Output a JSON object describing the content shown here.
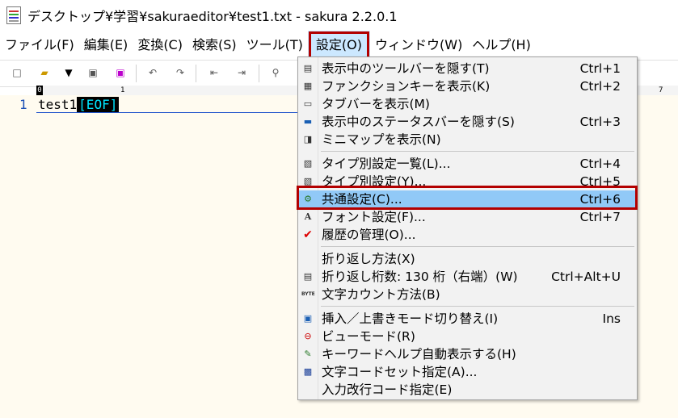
{
  "window": {
    "title": "デスクトップ¥学習¥sakuraeditor¥test1.txt - sakura 2.2.0.1"
  },
  "menubar": [
    "ファイル(F)",
    "編集(E)",
    "変換(C)",
    "検索(S)",
    "ツール(T)",
    "設定(O)",
    "ウィンドウ(W)",
    "ヘルプ(H)"
  ],
  "editor": {
    "line_number": "1",
    "text": "test1",
    "eof_marker": "[EOF]"
  },
  "ruler": {
    "start": "0",
    "mark10": "1",
    "mark70": "7"
  },
  "settings_menu": {
    "items": [
      {
        "label": "表示中のツールバーを隠す(T)",
        "shortcut": "Ctrl+1",
        "icon": "toolbar-icon"
      },
      {
        "label": "ファンクションキーを表示(K)",
        "shortcut": "Ctrl+2",
        "icon": "function-key-icon"
      },
      {
        "label": "タブバーを表示(M)",
        "shortcut": "",
        "icon": "tabbar-icon"
      },
      {
        "label": "表示中のステータスバーを隠す(S)",
        "shortcut": "Ctrl+3",
        "icon": "statusbar-icon"
      },
      {
        "label": "ミニマップを表示(N)",
        "shortcut": "",
        "icon": "minimap-icon"
      },
      {
        "label": "タイプ別設定一覧(L)...",
        "shortcut": "Ctrl+4",
        "icon": "type-list-icon"
      },
      {
        "label": "タイプ別設定(Y)...",
        "shortcut": "Ctrl+5",
        "icon": "type-settings-icon"
      },
      {
        "label": "共通設定(C)...",
        "shortcut": "Ctrl+6",
        "icon": "common-settings-icon"
      },
      {
        "label": "フォント設定(F)...",
        "shortcut": "Ctrl+7",
        "icon": "font-icon"
      },
      {
        "label": "履歴の管理(O)...",
        "shortcut": "",
        "icon": "checkmark-icon"
      },
      {
        "label": "折り返し方法(X)",
        "shortcut": "",
        "icon": ""
      },
      {
        "label": "折り返し桁数: 130 桁（右端）(W)",
        "shortcut": "Ctrl+Alt+U",
        "icon": "wrap-width-icon"
      },
      {
        "label": "文字カウント方法(B)",
        "shortcut": "",
        "icon": "byte-count-icon"
      },
      {
        "label": "挿入／上書きモード切り替え(I)",
        "shortcut": "Ins",
        "icon": "insert-mode-icon"
      },
      {
        "label": "ビューモード(R)",
        "shortcut": "",
        "icon": "view-mode-icon"
      },
      {
        "label": "キーワードヘルプ自動表示する(H)",
        "shortcut": "",
        "icon": "keyword-help-icon"
      },
      {
        "label": "文字コードセット指定(A)...",
        "shortcut": "",
        "icon": "charset-icon"
      },
      {
        "label": "入力改行コード指定(E)",
        "shortcut": "",
        "icon": ""
      }
    ]
  },
  "colors": {
    "accent_highlight": "#b30000",
    "selection": "#91c9f7",
    "menu_active": "#cce8ff"
  }
}
